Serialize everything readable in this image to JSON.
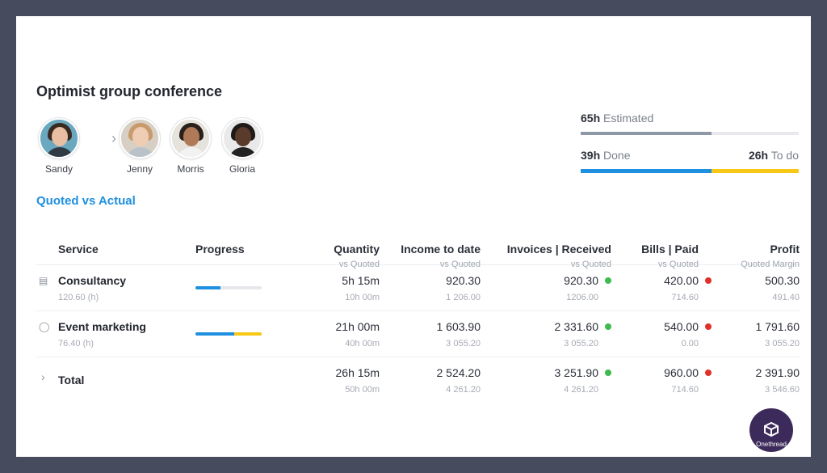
{
  "title": "Optimist group conference",
  "people": {
    "owner": {
      "name": "Sandy"
    },
    "members": [
      {
        "name": "Jenny"
      },
      {
        "name": "Morris"
      },
      {
        "name": "Gloria"
      }
    ]
  },
  "estimate": {
    "estimated_value": "65h",
    "estimated_label": "Estimated",
    "done_value": "39h",
    "done_label": "Done",
    "todo_value": "26h",
    "todo_label": "To do",
    "done_fraction": 0.6
  },
  "section_link": "Quoted vs Actual",
  "table": {
    "headers": {
      "service": "Service",
      "progress": "Progress",
      "quantity": {
        "main": "Quantity",
        "sub": "vs Quoted"
      },
      "income": {
        "main": "Income to date",
        "sub": "vs Quoted"
      },
      "invoices": {
        "main": "Invoices | Received",
        "sub": "vs Quoted"
      },
      "bills": {
        "main": "Bills | Paid",
        "sub": "vs Quoted"
      },
      "profit": {
        "main": "Profit",
        "sub": "Quoted Margin"
      }
    },
    "rows": [
      {
        "icon": "building-icon",
        "service": "Consultancy",
        "service_sub": "120.60 (h)",
        "progress_blue": 0.38,
        "progress_yellow": 0,
        "quantity": "5h 15m",
        "quantity_sub": "10h 00m",
        "income": "920.30",
        "income_sub": "1 206.00",
        "invoices": "920.30",
        "invoices_sub": "1206.00",
        "invoices_status": "green",
        "bills": "420.00",
        "bills_sub": "714.60",
        "bills_status": "red",
        "profit": "500.30",
        "profit_sub": "491.40"
      },
      {
        "icon": "person-icon",
        "service": "Event marketing",
        "service_sub": "76.40 (h)",
        "progress_blue": 0.58,
        "progress_yellow": 0.42,
        "quantity": "21h 00m",
        "quantity_sub": "40h 00m",
        "income": "1 603.90",
        "income_sub": "3 055.20",
        "invoices": "2 331.60",
        "invoices_sub": "3 055.20",
        "invoices_status": "green",
        "bills": "540.00",
        "bills_sub": "0.00",
        "bills_status": "red",
        "profit": "1 791.60",
        "profit_sub": "3 055.20"
      }
    ],
    "total": {
      "label": "Total",
      "quantity": "26h 15m",
      "quantity_sub": "50h 00m",
      "income": "2 524.20",
      "income_sub": "4 261.20",
      "invoices": "3 251.90",
      "invoices_sub": "4 261.20",
      "invoices_status": "green",
      "bills": "960.00",
      "bills_sub": "714.60",
      "bills_status": "red",
      "profit": "2 391.90",
      "profit_sub": "3 546.60"
    }
  },
  "brand": {
    "name": "Onethread",
    "color": "#3c2a5a"
  },
  "colors": {
    "accent": "#1f8fe0",
    "todo": "#f7c815",
    "ok": "#3dbb4f",
    "due": "#e0302a"
  }
}
